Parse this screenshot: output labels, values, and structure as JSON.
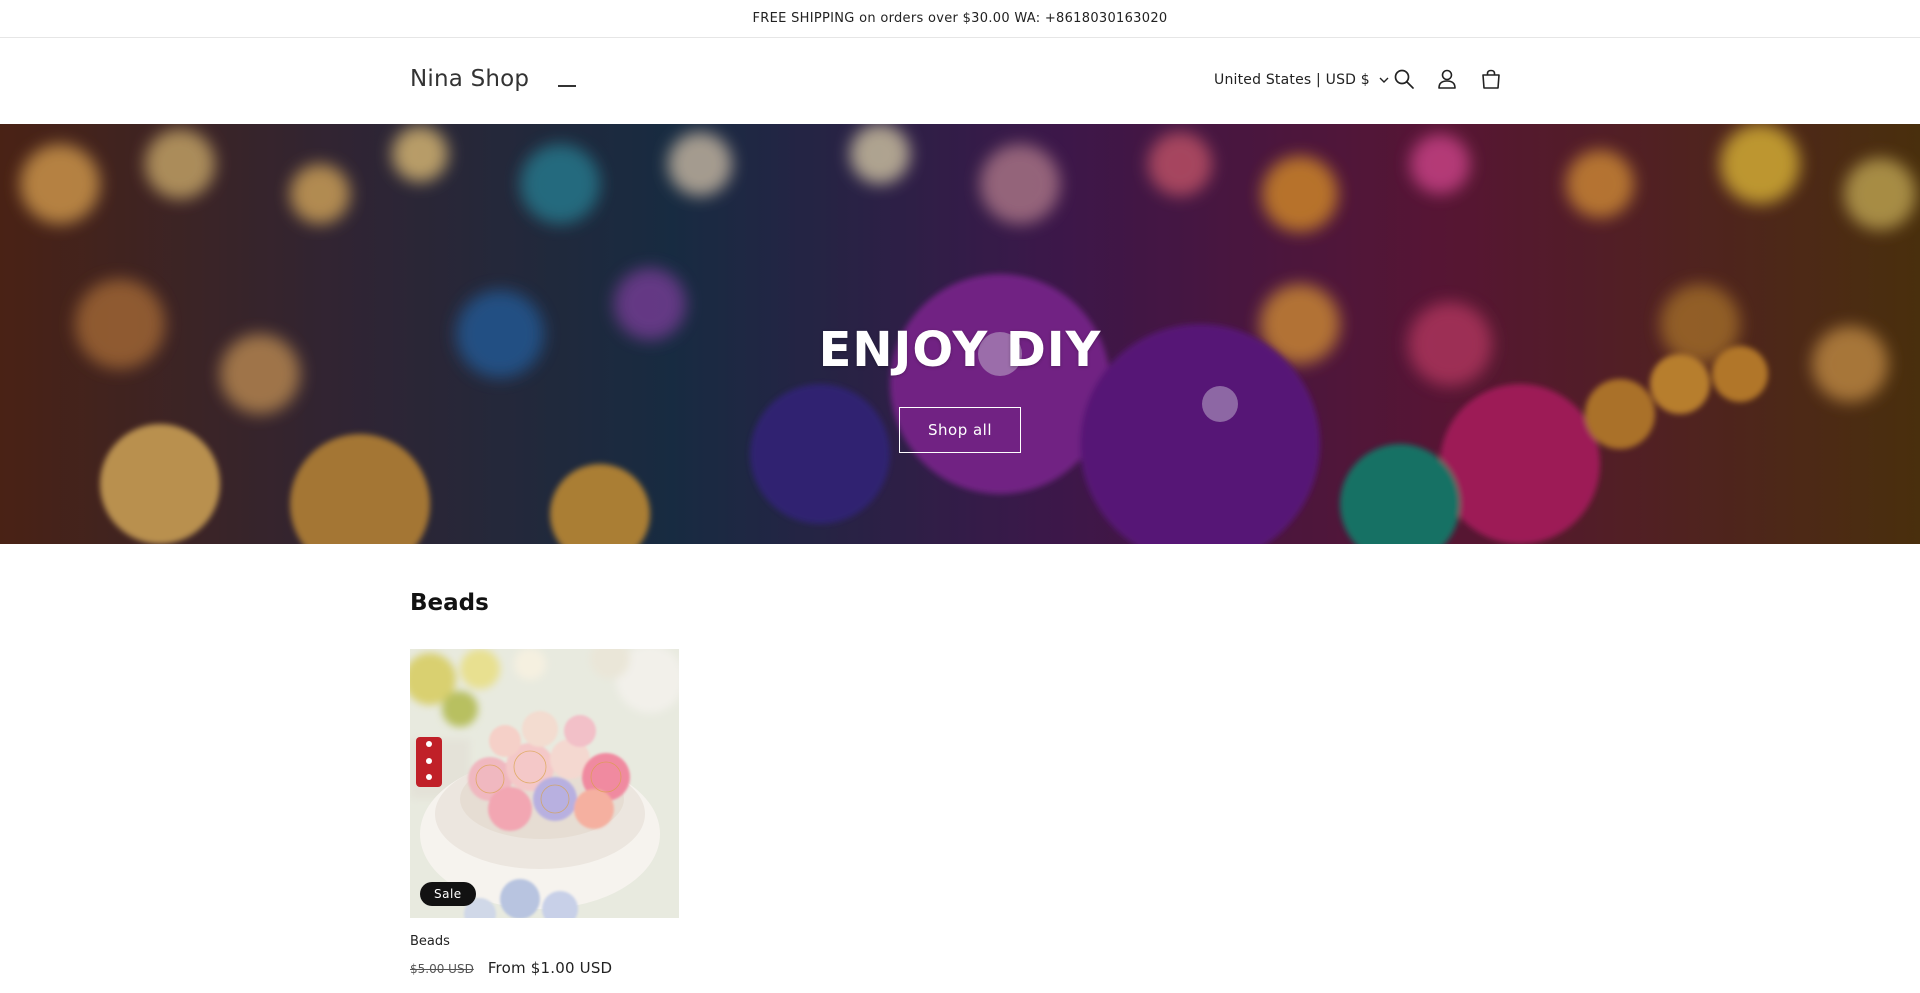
{
  "announcement": "FREE SHIPPING on orders over $30.00 WA: +8618030163020",
  "header": {
    "logo": "Nina Shop",
    "country_selector": "United States | USD $",
    "icons": [
      "menu-icon",
      "search-icon",
      "account-icon",
      "cart-icon"
    ]
  },
  "hero": {
    "title": "ENJOY DIY",
    "button": "Shop all"
  },
  "collection": {
    "title": "Beads",
    "products": [
      {
        "title": "Beads",
        "badge": "Sale",
        "compare_price": "$5.00 USD",
        "price": "From $1.00 USD"
      }
    ]
  },
  "colors": {
    "text": "#121212",
    "badge_bg": "#121212",
    "border": "#e6e6e6"
  }
}
